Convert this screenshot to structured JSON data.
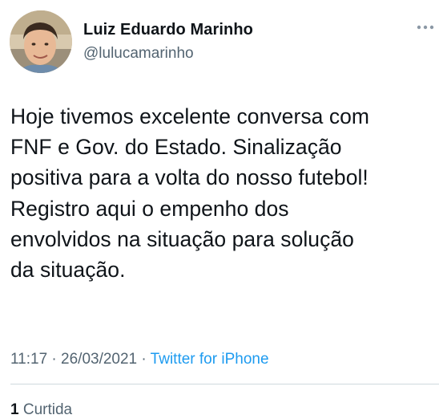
{
  "author": {
    "name": "Luiz Eduardo Marinho",
    "handle": "@lulucamarinho",
    "avatar": "profile-photo"
  },
  "tweet": {
    "text": "Hoje tivemos excelente conversa com\nFNF e Gov. do Estado. Sinalização\npositiva para a volta do nosso futebol!\nRegistro aqui o empenho dos\nenvolvidos na situação para solução\nda situação.",
    "time": "11:17",
    "separator_1": " · ",
    "date": "26/03/2021",
    "separator_2": " · ",
    "source": "Twitter for iPhone"
  },
  "stats": {
    "likes_count": "1",
    "likes_label": " Curtida"
  },
  "icons": {
    "more": "more-horizontal-icon"
  },
  "colors": {
    "text": "#0f1419",
    "secondary": "#536471",
    "link": "#1d9bf0",
    "divider": "#cfd9de"
  }
}
